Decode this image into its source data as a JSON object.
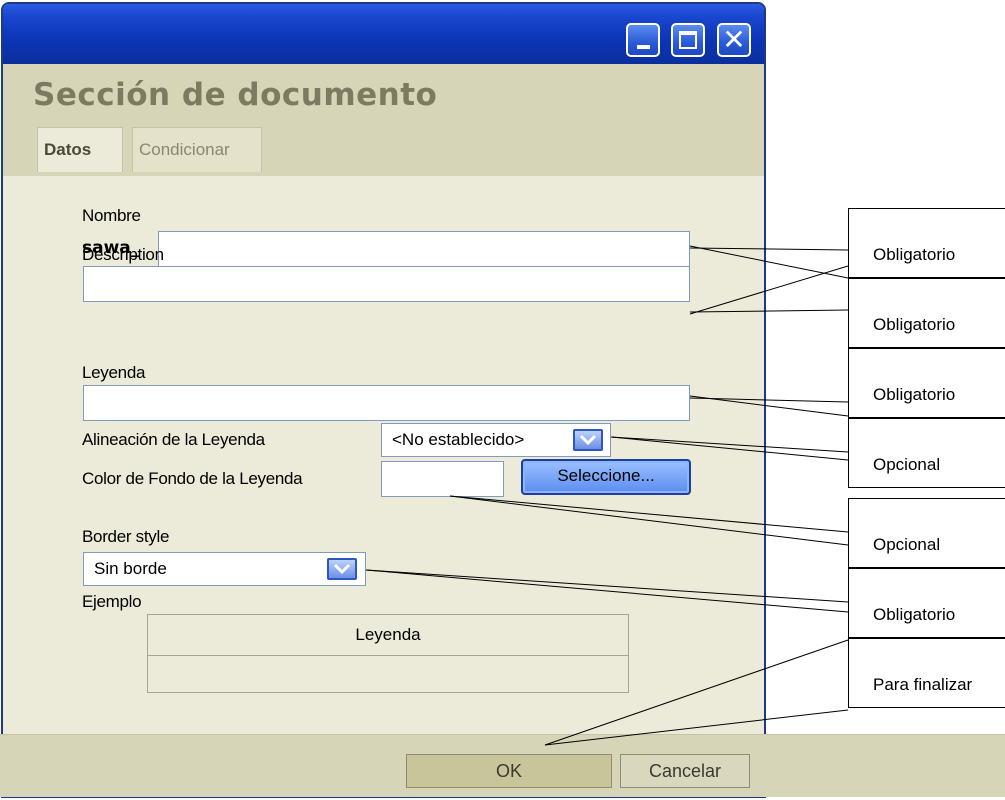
{
  "window": {
    "title": "Sección de documento",
    "tabs": [
      "Datos",
      "Condicionar"
    ]
  },
  "form": {
    "nombre": {
      "label": "Nombre",
      "prefix": "sawa_",
      "value": ""
    },
    "description": {
      "label": "Description",
      "value": ""
    },
    "leyenda": {
      "label": "Leyenda",
      "value": ""
    },
    "alineacion": {
      "label": "Alineación de la Leyenda",
      "value": "<No establecido>"
    },
    "color_fondo": {
      "label": "Color de Fondo de la Leyenda",
      "value": "",
      "button": "Seleccione..."
    },
    "border_style": {
      "label": "Border style",
      "value": "Sin borde"
    },
    "ejemplo": {
      "label": "Ejemplo",
      "caption": "Leyenda"
    }
  },
  "footer": {
    "ok": "OK",
    "cancel": "Cancelar"
  },
  "callouts": [
    "Obligatorio",
    "Obligatorio",
    "Obligatorio",
    "Opcional",
    "Opcional",
    "Obligatorio",
    "Para finalizar"
  ],
  "colors": {
    "titlebar": "#0c35b6",
    "panel": "#ecead8",
    "header": "#d7d5b7",
    "title_text": "#7d7a62"
  }
}
